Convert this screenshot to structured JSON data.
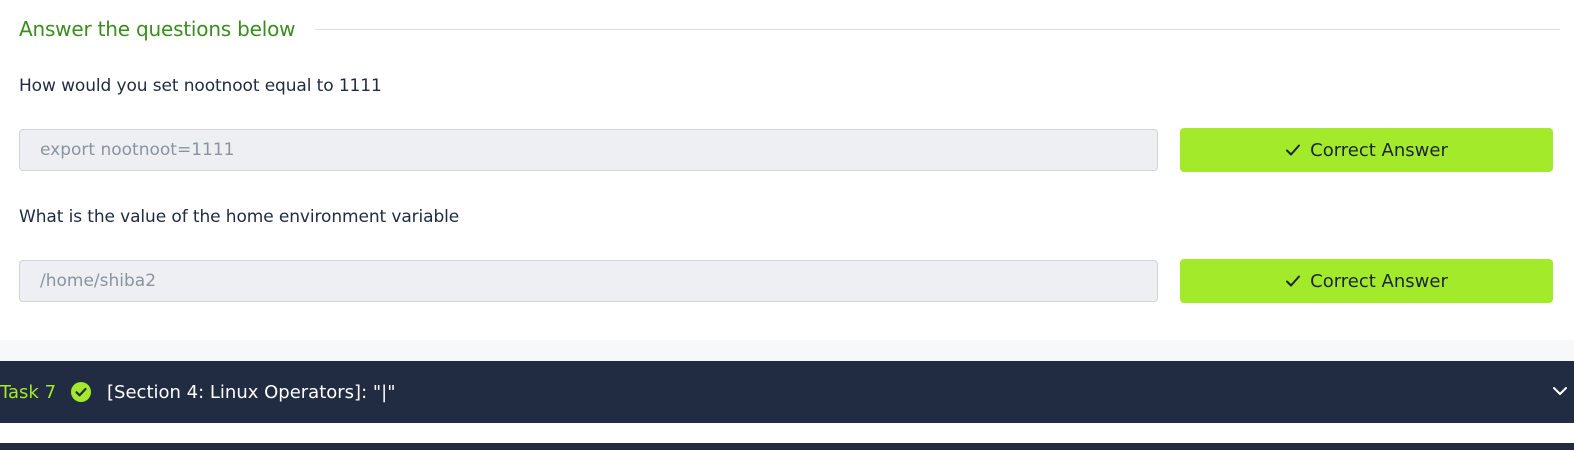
{
  "section": {
    "title": "Answer the questions below"
  },
  "questions": [
    {
      "text": "How would you set nootnoot equal to 1111",
      "answer": "export nootnoot=1111",
      "status_label": "Correct Answer"
    },
    {
      "text": "What is the value of the home environment variable",
      "answer": "/home/shiba2",
      "status_label": "Correct Answer"
    }
  ],
  "task": {
    "number": "Task 7",
    "title": "[Section 4: Linux Operators]: \"|\""
  },
  "icons": {
    "correct": "check-icon",
    "task_status": "check-circle-icon",
    "expand": "chevron-down-icon"
  },
  "colors": {
    "accent": "#a3ea2a",
    "heading": "#3a8d1e",
    "dark": "#212c42"
  }
}
